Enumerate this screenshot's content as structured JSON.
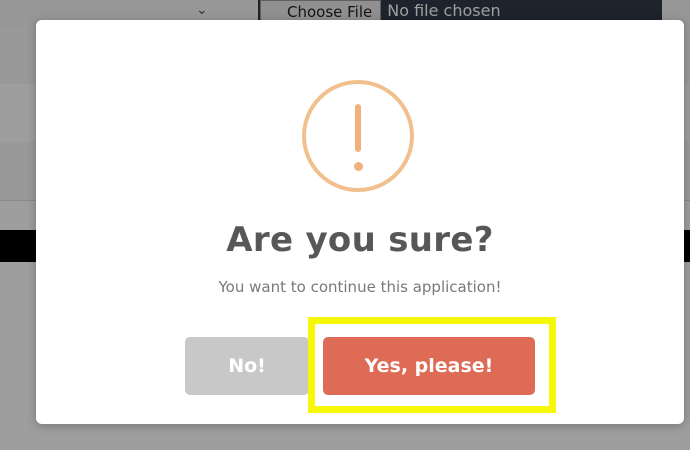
{
  "background": {
    "file_input": {
      "button_label": "Choose File",
      "status_text": "No file chosen"
    }
  },
  "dialog": {
    "title": "Are you sure?",
    "message": "You want to continue this application!",
    "icon": "exclamation-circle-icon",
    "cancel_label": "No!",
    "confirm_label": "Yes, please!",
    "colors": {
      "confirm": "#dd6b55",
      "cancel": "#c8c8c8",
      "icon": "#f0b27a",
      "highlight": "#f7f70a"
    }
  }
}
